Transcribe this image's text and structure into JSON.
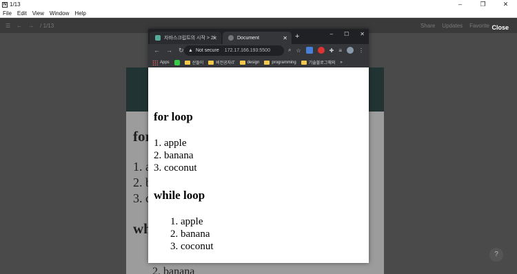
{
  "notion": {
    "window_title": "1/13",
    "menu": [
      "File",
      "Edit",
      "View",
      "Window",
      "Help"
    ],
    "breadcrumb": "/ 1/13",
    "top_right": [
      "Share",
      "Updates",
      "Favorite"
    ],
    "close_label": "Close",
    "help": "?"
  },
  "bg_doc": {
    "heading": "for",
    "items": [
      "1. a",
      "2. b",
      "3. c"
    ],
    "heading2": "wh",
    "bottom_items": [
      "2. banana"
    ]
  },
  "chrome": {
    "tab1": "자바스크립트의 시작 > 2/",
    "tab2": "Document",
    "address_prefix": "Not secure",
    "url": "172.17.166.193:5500",
    "bookmarks": [
      "Apps",
      "산들이",
      "비전공자IT",
      "design",
      "programming",
      "기술블로그해외"
    ],
    "more": "»"
  },
  "page": {
    "for_title": "for loop",
    "for_items": [
      "1. apple",
      "2. banana",
      "3. coconut"
    ],
    "while_title": "while loop",
    "while_items": [
      "1. apple",
      "2. banana",
      "3. coconut"
    ]
  }
}
